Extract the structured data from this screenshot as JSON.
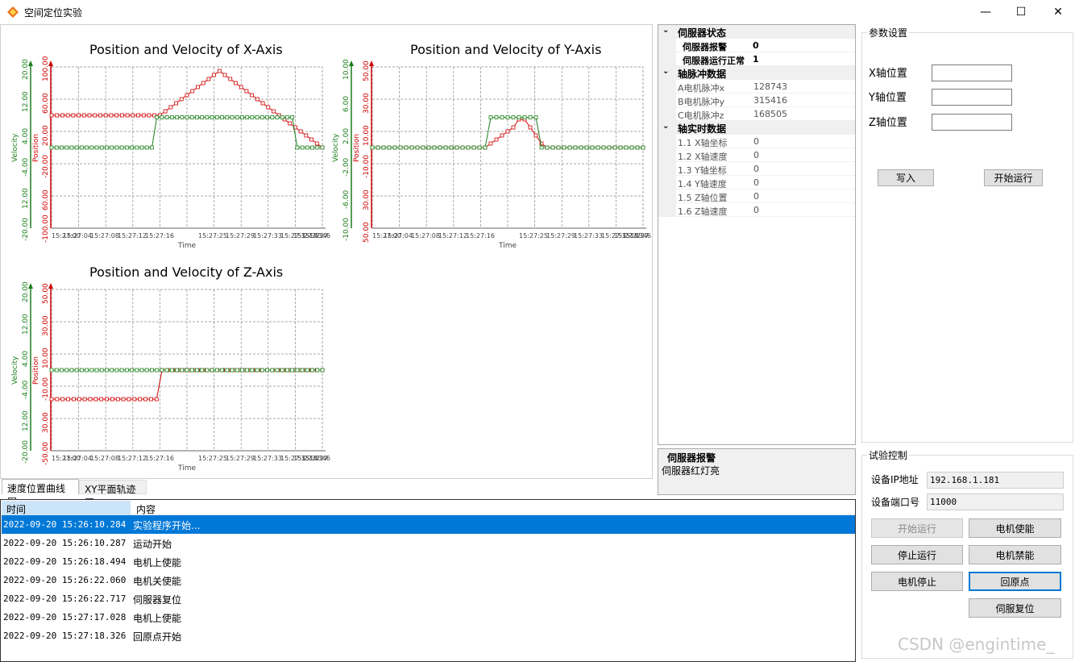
{
  "window": {
    "title": "空间定位实验",
    "min_glyph": "—",
    "max_glyph": "☐",
    "close_glyph": "✕"
  },
  "tabs": [
    "速度位置曲线图",
    "XY平面轨迹图"
  ],
  "charts": [
    {
      "title": "Position and Velocity of X-Axis",
      "vel_ticks": [
        "20.00",
        "12.00",
        "4.00",
        "-4.00",
        "12.00",
        "-20.00"
      ],
      "pos_ticks": [
        "100.00",
        "60.00",
        "20.00",
        "-20.00",
        "60.00",
        "-100.00"
      ],
      "x_ticks": [
        "15:27:00",
        "15:27:04",
        "15:27:08",
        "15:27:12",
        "15:27:16",
        "15:27:25",
        "15:27:29",
        "15:27:33",
        "15:27:35",
        "15:27:43",
        "15:27:46",
        "15:27"
      ],
      "position_series": [
        40,
        40,
        40,
        40,
        40,
        40,
        40,
        40,
        40,
        40,
        40,
        40,
        40,
        40,
        40,
        40,
        40,
        40,
        40,
        40,
        40,
        45,
        50,
        55,
        60,
        65,
        70,
        75,
        80,
        85,
        90,
        95,
        90,
        85,
        80,
        75,
        70,
        65,
        60,
        55,
        50,
        45,
        40,
        35,
        30,
        25,
        20,
        15,
        10,
        5,
        0
      ],
      "velocity_series": [
        0,
        0,
        0,
        0,
        0,
        0,
        0,
        0,
        0,
        0,
        0,
        0,
        0,
        0,
        0,
        0,
        0,
        0,
        0,
        0,
        0,
        10,
        10,
        10,
        10,
        10,
        10,
        10,
        10,
        10,
        10,
        10,
        10,
        10,
        10,
        10,
        10,
        10,
        10,
        10,
        10,
        10,
        10,
        10,
        10,
        10,
        10,
        10,
        10,
        0,
        0,
        0,
        0,
        0,
        0
      ]
    },
    {
      "title": "Position and Velocity of Y-Axis",
      "vel_ticks": [
        "10.00",
        "6.00",
        "2.00",
        "-2.00",
        "-6.00",
        "-10.00"
      ],
      "pos_ticks": [
        "50.00",
        "30.00",
        "10.00",
        "-10.00",
        "30.00",
        "50.00"
      ],
      "x_ticks": [
        "15:27:00",
        "15:27:04",
        "15:27:08",
        "15:27:12",
        "15:27:16",
        "15:27:25",
        "15:27:29",
        "15:27:33",
        "15:27:35",
        "15:27:43",
        "15:27:46",
        "15:27"
      ],
      "position_series": [
        0,
        0,
        0,
        0,
        0,
        0,
        0,
        0,
        0,
        0,
        0,
        0,
        0,
        0,
        0,
        0,
        0,
        0,
        0,
        0,
        0,
        5,
        10,
        15,
        20,
        25,
        35,
        35,
        25,
        15,
        5,
        0,
        0,
        0,
        0,
        0,
        0,
        0,
        0,
        0,
        0,
        0,
        0,
        0,
        0,
        0,
        0,
        0,
        0
      ],
      "velocity_series": [
        0,
        0,
        0,
        0,
        0,
        0,
        0,
        0,
        0,
        0,
        0,
        0,
        0,
        0,
        0,
        0,
        0,
        0,
        0,
        0,
        0,
        10,
        10,
        10,
        10,
        10,
        10,
        10,
        10,
        10,
        0,
        0,
        0,
        0,
        0,
        0,
        0,
        0,
        0,
        0,
        0,
        0,
        0,
        0,
        0,
        0,
        0,
        0,
        0
      ]
    },
    {
      "title": "Position and Velocity of Z-Axis",
      "vel_ticks": [
        "20.00",
        "12.00",
        "4.00",
        "-4.00",
        "12.00",
        "-20.00"
      ],
      "pos_ticks": [
        "50.00",
        "30.00",
        "10.00",
        "-10.00",
        "30.00",
        "-50.00"
      ],
      "x_ticks": [
        "15:27:00",
        "15:27:04",
        "15:27:08",
        "15:27:12",
        "15:27:16",
        "15:27:25",
        "15:27:29",
        "15:27:33",
        "15:27:35",
        "15:27:43",
        "15:27:46",
        "15:27"
      ],
      "position_series": [
        -36,
        -36,
        -36,
        -36,
        -36,
        -36,
        -36,
        -36,
        -36,
        -36,
        -36,
        -36,
        -36,
        -36,
        -36,
        -36,
        -36,
        -36,
        -36,
        -36,
        0,
        0,
        0,
        0,
        0,
        0,
        0,
        0,
        0,
        0,
        0,
        0,
        0,
        0,
        0,
        0,
        0,
        0,
        0,
        0,
        0,
        0,
        0,
        0,
        0,
        0,
        0,
        0,
        0,
        0
      ],
      "velocity_series": [
        0,
        0,
        0,
        0,
        0,
        0,
        0,
        0,
        0,
        0,
        0,
        0,
        0,
        0,
        0,
        0,
        0,
        0,
        0,
        0,
        0,
        0,
        0,
        0,
        0,
        0,
        0,
        0,
        0,
        0,
        0,
        0,
        0,
        0,
        0,
        0,
        0,
        0,
        0,
        0,
        0,
        0,
        0,
        0,
        0,
        0,
        0,
        0,
        0,
        0,
        0,
        0,
        0,
        0,
        0
      ]
    }
  ],
  "chart_labels": {
    "velocity": "Velocity",
    "position": "Position",
    "time": "Time"
  },
  "property_grid": {
    "categories": [
      {
        "label": "伺服器状态",
        "rows": [
          {
            "name": "伺服器报警",
            "value": "0"
          },
          {
            "name": "伺服器运行正常",
            "value": "1"
          }
        ]
      },
      {
        "label": "轴脉冲数据",
        "rows": [
          {
            "name": "A电机脉冲x",
            "value": "128743"
          },
          {
            "name": "B电机脉冲y",
            "value": "315416"
          },
          {
            "name": "C电机脉冲z",
            "value": "168505"
          }
        ]
      },
      {
        "label": "轴实时数据",
        "rows": [
          {
            "name": "1.1 X轴坐标",
            "value": "0"
          },
          {
            "name": "1.2 X轴速度",
            "value": "0"
          },
          {
            "name": "1.3 Y轴坐标",
            "value": "0"
          },
          {
            "name": "1.4 Y轴速度",
            "value": "0"
          },
          {
            "name": "1.5 Z轴位置",
            "value": "0"
          },
          {
            "name": "1.6 Z轴速度",
            "value": "0"
          }
        ]
      }
    ],
    "description_title": "伺服器报警",
    "description_text": "伺服器红灯亮"
  },
  "params": {
    "group_title": "参数设置",
    "x_label": "X轴位置",
    "y_label": "Y轴位置",
    "z_label": "Z轴位置",
    "x_value": "",
    "y_value": "",
    "z_value": "",
    "write_button": "写入",
    "start_button": "开始运行"
  },
  "control": {
    "group_title": "试验控制",
    "ip_label": "设备IP地址",
    "ip_value": "192.168.1.181",
    "port_label": "设备端口号",
    "port_value": "11000",
    "buttons": {
      "start": "开始运行",
      "enable": "电机使能",
      "stop_run": "停止运行",
      "disable": "电机禁能",
      "motor_stop": "电机停止",
      "home": "回原点",
      "servo_reset": "伺服复位"
    }
  },
  "log": {
    "headers": [
      "时间",
      "内容"
    ],
    "rows": [
      {
        "time": "2022-09-20 15:26:10.284",
        "content": "实验程序开始..."
      },
      {
        "time": "2022-09-20 15:26:10.287",
        "content": "运动开始"
      },
      {
        "time": "2022-09-20 15:26:18.494",
        "content": "电机上使能"
      },
      {
        "time": "2022-09-20 15:26:22.060",
        "content": "电机关使能"
      },
      {
        "time": "2022-09-20 15:26:22.717",
        "content": "伺服器复位"
      },
      {
        "time": "2022-09-20 15:27:17.028",
        "content": "电机上使能"
      },
      {
        "time": "2022-09-20 15:27:18.326",
        "content": "回原点开始"
      }
    ]
  },
  "watermark": "CSDN @engintime_",
  "colors": {
    "velocity": "#1a7f1a",
    "position": "#d00000",
    "selection": "#0078d7",
    "grid": "#8a8a8a"
  }
}
